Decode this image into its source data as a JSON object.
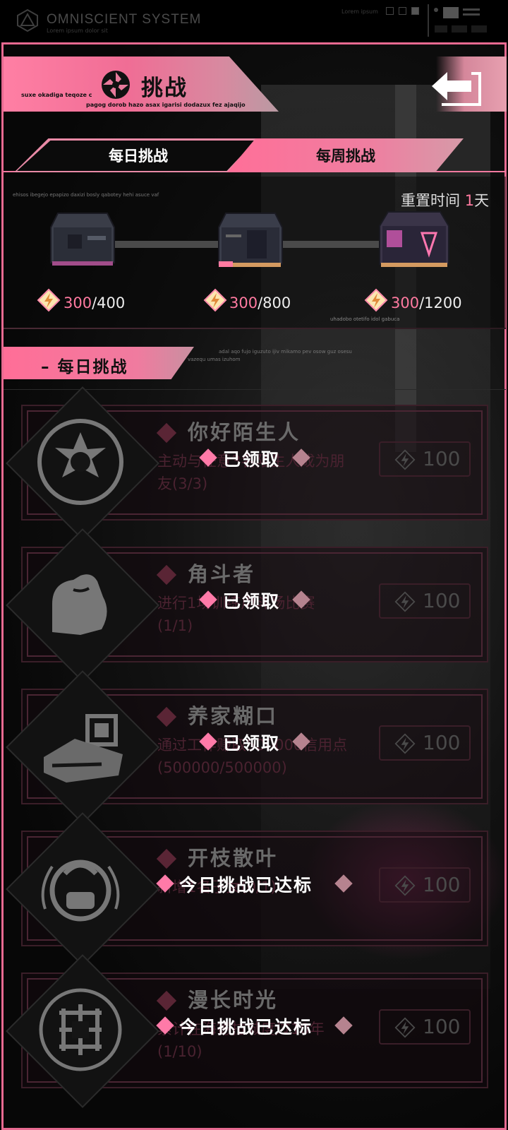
{
  "system": {
    "title": "OMNISCIENT SYSTEM",
    "subtitle": "Lorem ipsum dolor sit",
    "lorem": "Lorem ipsum"
  },
  "header": {
    "title": "挑战",
    "latin1": "suxe okadiga teqoze c",
    "latin2": "pagog dorob hazo asax igarisi dodazux fez ajaqijo",
    "back_icon": "back-arrow-icon"
  },
  "tabs": [
    {
      "label": "每日挑战",
      "active": false
    },
    {
      "label": "每周挑战",
      "active": true
    }
  ],
  "weekly": {
    "latin": "ehisos ibegejo epapizo daxizi bosly qabotey hehi asuce vaf",
    "reset_label": "重置时间",
    "reset_value": "1",
    "reset_unit": "天",
    "latin2": "uhadobo otetifo idol gabuca",
    "rewards": [
      {
        "current": "300",
        "target": "/400",
        "icon": "chest-icon"
      },
      {
        "current": "300",
        "target": "/800",
        "icon": "chest-icon"
      },
      {
        "current": "300",
        "target": "/1200",
        "icon": "chest-icon"
      }
    ],
    "currency_icon": "lightning-diamond-icon"
  },
  "section": {
    "title": "– 每日挑战",
    "latin1": "adal aqo fujo iguzuto ijiv mikamo pev osow guz osesu",
    "latin2": "vazequ umas izuhom"
  },
  "challenges": [
    {
      "title": "你好陌生人",
      "desc": "主动与任意3名陌生人成为朋友(3/3)",
      "points": "100",
      "status": "已领取",
      "icon": "handshake-emblem-icon"
    },
    {
      "title": "角斗者",
      "desc": "进行1场训练用斗场比赛(1/1)",
      "points": "100",
      "status": "已领取",
      "icon": "flexed-arm-icon"
    },
    {
      "title": "养家糊口",
      "desc": "通过工作赚取500000信用点(500000/500000)",
      "points": "100",
      "status": "已领取",
      "icon": "money-hand-icon"
    },
    {
      "title": "开枝散叶",
      "desc": "新增1名子女(0/1)",
      "points": "100",
      "status": "今日挑战已达标",
      "icon": "baby-icon"
    },
    {
      "title": "漫长时光",
      "desc": "累计在海德拉城度过10年(1/10)",
      "points": "100",
      "status": "今日挑战已达标",
      "icon": "knot-emblem-icon"
    }
  ],
  "colors": {
    "accent": "#f06d95",
    "frame": "#e86a91",
    "status_diamond": "#ff7aa8"
  }
}
